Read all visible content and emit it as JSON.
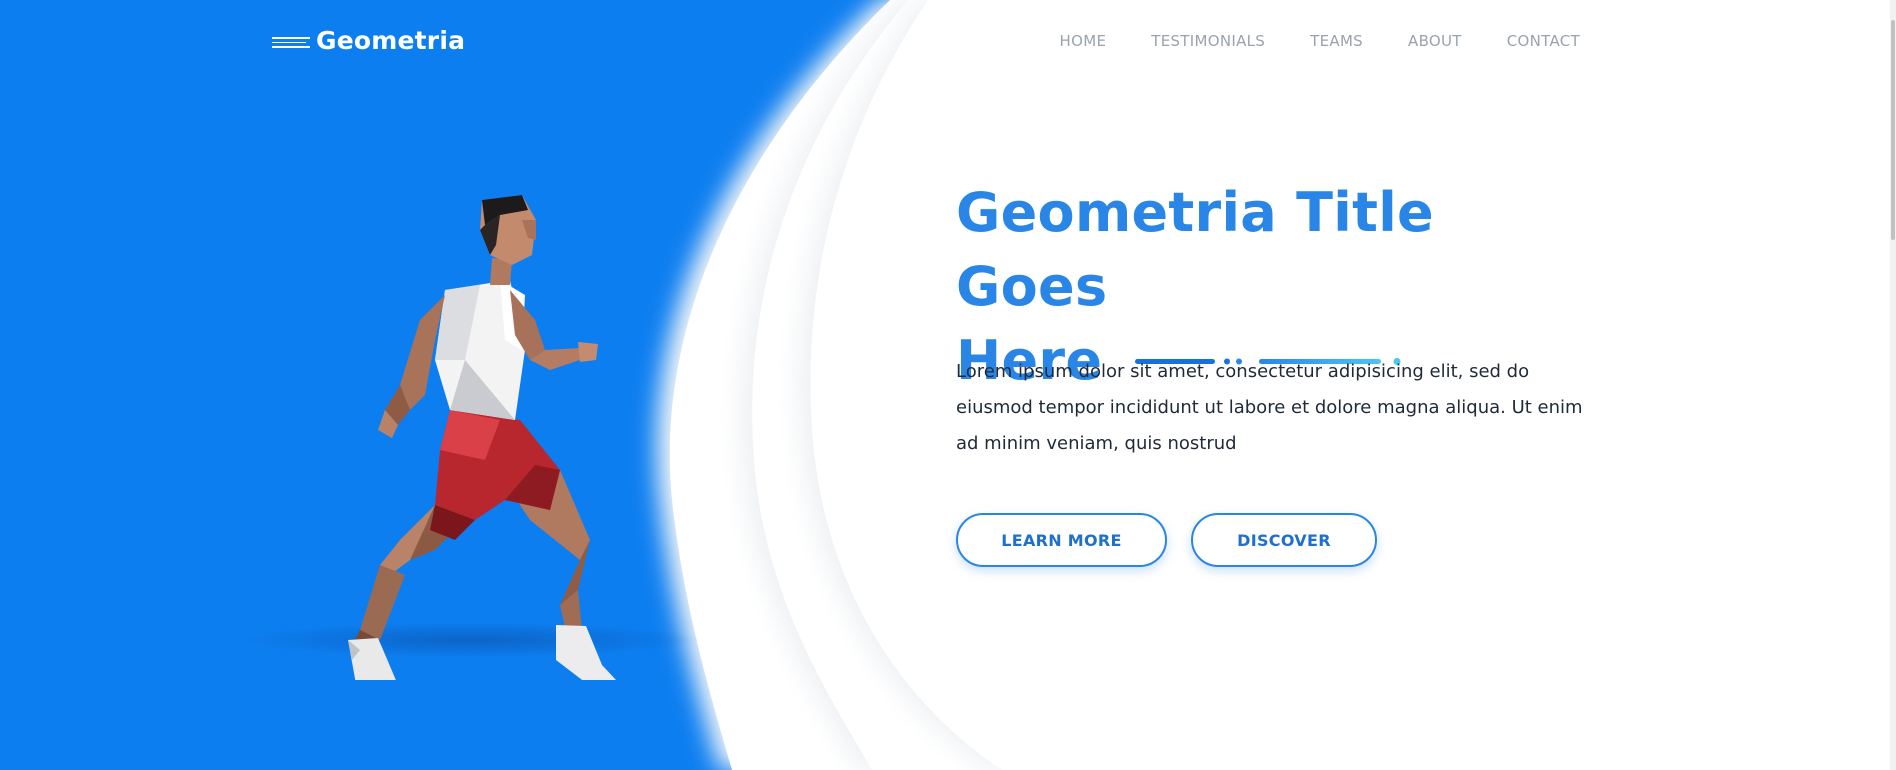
{
  "brand": {
    "name": "Geometria",
    "logo_icon": "speed-lines-icon"
  },
  "nav": {
    "items": [
      {
        "label": "HOME"
      },
      {
        "label": "TESTIMONIALS"
      },
      {
        "label": "TEAMS"
      },
      {
        "label": "ABOUT"
      },
      {
        "label": "CONTACT"
      }
    ]
  },
  "hero": {
    "title_line1": "Geometria Title Goes",
    "title_line2": "Here",
    "description": "Lorem ipsum dolor sit amet, consectetur adipisicing elit, sed do eiusmod tempor incididunt ut labore et dolore magna aliqua. Ut enim ad minim veniam, quis nostrud",
    "buttons": {
      "learn_more": "LEARN MORE",
      "discover": "DISCOVER"
    },
    "illustration": "low-poly-runner-illustration"
  },
  "colors": {
    "brand_blue": "#0d7ef0",
    "title_blue": "#2a86e6",
    "nav_gray": "#9aa3ad",
    "text_dark": "#1e2a38",
    "background": "#ffffff"
  }
}
